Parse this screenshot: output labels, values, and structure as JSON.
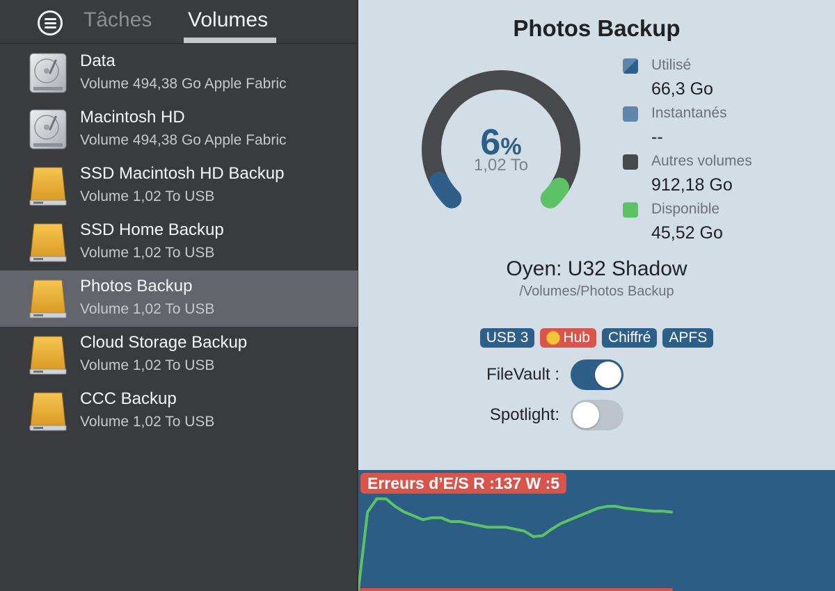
{
  "sidebar": {
    "tabs": [
      {
        "label": "Tâches",
        "active": false
      },
      {
        "label": "Volumes",
        "active": true
      }
    ],
    "volumes": [
      {
        "name": "Data",
        "subtitle": "Volume 494,38 Go Apple Fabric",
        "icon": "internal-disk-icon",
        "selected": false
      },
      {
        "name": "Macintosh HD",
        "subtitle": "Volume 494,38 Go Apple Fabric",
        "icon": "internal-disk-icon",
        "selected": false
      },
      {
        "name": "SSD Macintosh HD Backup",
        "subtitle": "Volume 1,02 To USB",
        "icon": "external-disk-icon",
        "selected": false
      },
      {
        "name": "SSD Home Backup",
        "subtitle": "Volume 1,02 To USB",
        "icon": "external-disk-icon",
        "selected": false
      },
      {
        "name": "Photos Backup",
        "subtitle": "Volume 1,02 To USB",
        "icon": "external-disk-icon",
        "selected": true
      },
      {
        "name": "Cloud Storage Backup",
        "subtitle": "Volume 1,02 To USB",
        "icon": "external-disk-icon",
        "selected": false
      },
      {
        "name": "CCC Backup",
        "subtitle": "Volume 1,02 To USB",
        "icon": "external-disk-icon",
        "selected": false
      }
    ]
  },
  "detail": {
    "title": "Photos Backup",
    "gauge": {
      "percent_value": "6",
      "percent_symbol": "%",
      "total": "1,02 To",
      "fractions": {
        "used": 0.065,
        "snapshots": 0.0,
        "other": 0.894,
        "free": 0.045
      }
    },
    "legend": [
      {
        "label": "Utilisé",
        "value": "66,3 Go",
        "color": "#2f5f88"
      },
      {
        "label": "Instantanés",
        "value": "--",
        "color": "#5f86aa"
      },
      {
        "label": "Autres volumes",
        "value": "912,18 Go",
        "color": "#47494c"
      },
      {
        "label": "Disponible",
        "value": "45,52 Go",
        "color": "#5cc266"
      }
    ],
    "device": "Oyen: U32 Shadow",
    "path": "/Volumes/Photos Backup",
    "badges": [
      {
        "label": "USB 3",
        "type": "normal"
      },
      {
        "label": "Hub",
        "type": "hub"
      },
      {
        "label": "Chiffré",
        "type": "normal"
      },
      {
        "label": "APFS",
        "type": "normal"
      }
    ],
    "toggles": [
      {
        "label": "FileVault :",
        "on": true
      },
      {
        "label": "Spotlight:",
        "on": false
      }
    ]
  },
  "graph": {
    "error_label": "Erreurs d’E/S R :137 W :5",
    "read_series": [
      0,
      82,
      96,
      96,
      88,
      82,
      78,
      74,
      76,
      76,
      72,
      72,
      70,
      68,
      66,
      66,
      66,
      64,
      62,
      56,
      57,
      64,
      70,
      74,
      78,
      82,
      86,
      88,
      88,
      86,
      85,
      84,
      83,
      83,
      82
    ],
    "write_series": [
      0,
      0,
      0,
      0,
      0,
      0,
      0,
      0,
      0,
      0,
      0,
      0,
      0,
      0,
      0,
      0,
      0,
      0,
      0,
      0,
      0,
      0,
      0,
      0,
      0,
      0,
      0,
      0,
      0,
      0,
      0,
      0,
      0,
      0,
      0
    ],
    "colors": {
      "read": "#5cc266",
      "write": "#d9554b",
      "background": "#2c5d84"
    }
  }
}
